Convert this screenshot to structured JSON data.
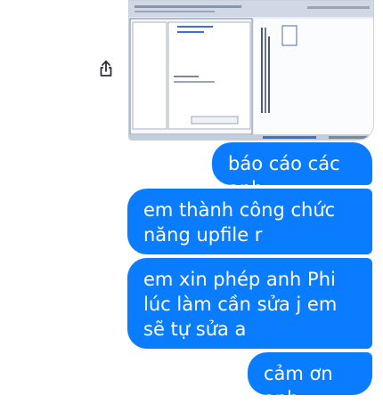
{
  "attachment": {
    "type": "screenshot-thumbnail"
  },
  "messages": [
    {
      "text": "báo cáo các anh"
    },
    {
      "text": "em thành công chức năng upfile r"
    },
    {
      "text": "em xin phép anh Phi lúc làm cần sửa j em sẽ tự sửa a"
    },
    {
      "text": "cảm ơn anh"
    }
  ],
  "icons": {
    "share": "share-icon"
  },
  "colors": {
    "bubble": "#0a7cff",
    "bubble_text": "#ffffff",
    "background": "#ffffff"
  }
}
